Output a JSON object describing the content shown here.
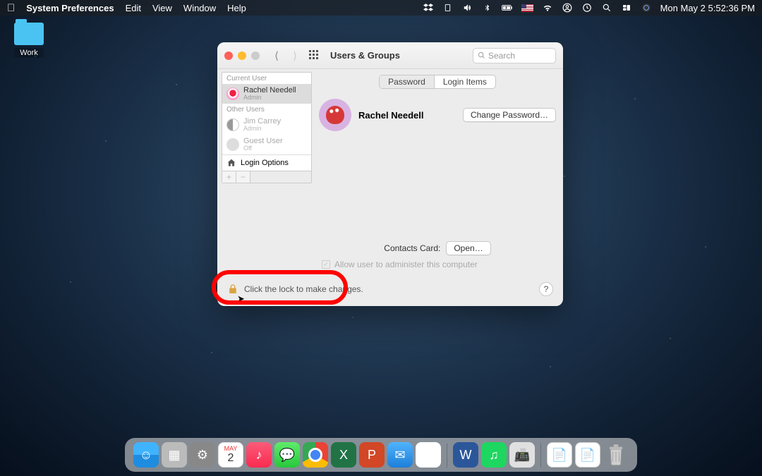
{
  "menubar": {
    "app_name": "System Preferences",
    "menus": [
      "Edit",
      "View",
      "Window",
      "Help"
    ],
    "datetime": "Mon May 2  5:52:36 PM"
  },
  "desktop": {
    "folder_label": "Work"
  },
  "window": {
    "title": "Users & Groups",
    "search_placeholder": "Search",
    "sidebar": {
      "current_header": "Current User",
      "other_header": "Other Users",
      "current_user": {
        "name": "Rachel Needell",
        "role": "Admin"
      },
      "other_users": [
        {
          "name": "Jim Carrey",
          "role": "Admin"
        },
        {
          "name": "Guest User",
          "role": "Off"
        }
      ],
      "login_options": "Login Options"
    },
    "tabs": {
      "password": "Password",
      "login_items": "Login Items"
    },
    "profile": {
      "name": "Rachel Needell",
      "change_password": "Change Password…"
    },
    "contacts_card_label": "Contacts Card:",
    "open_button": "Open…",
    "allow_admin": "Allow user to administer this computer",
    "lock_text": "Click the lock to make changes.",
    "help": "?"
  },
  "dock": {
    "calendar_month": "MAY",
    "calendar_day": "2"
  }
}
